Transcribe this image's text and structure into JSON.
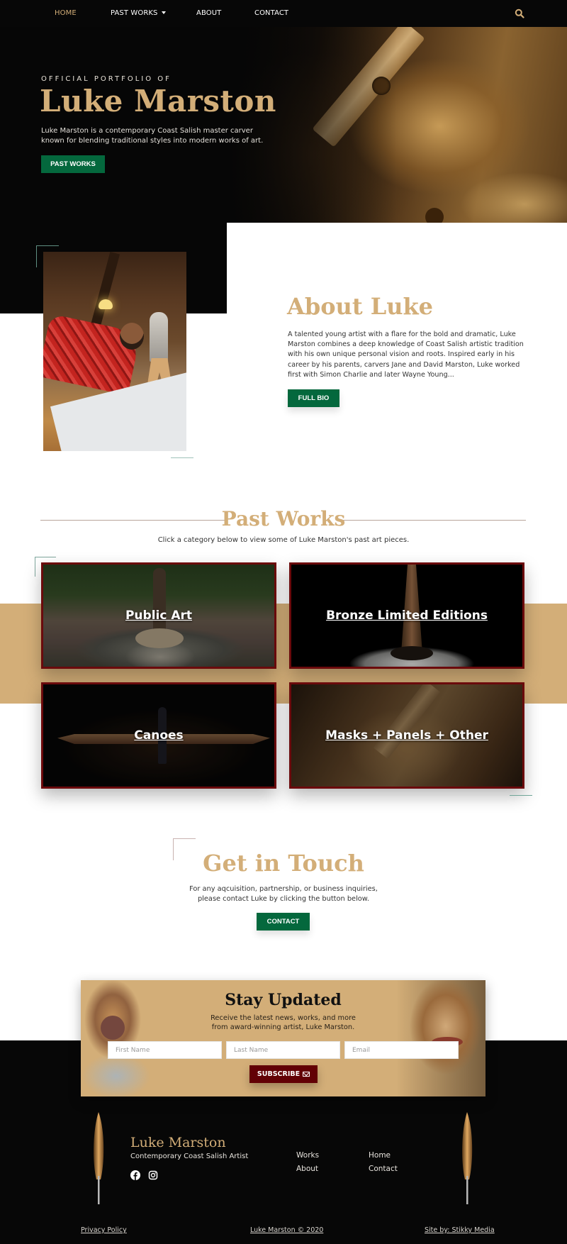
{
  "nav": {
    "items": [
      {
        "label": "HOME",
        "active": true
      },
      {
        "label": "PAST WORKS",
        "has_dropdown": true
      },
      {
        "label": "ABOUT"
      },
      {
        "label": "CONTACT"
      }
    ],
    "search_icon": "search-icon"
  },
  "hero": {
    "eyebrow": "OFFICIAL PORTFOLIO OF",
    "title": "Luke Marston",
    "description": "Luke Marston is a contemporary Coast Salish master carver known for blending traditional styles into modern works of art.",
    "button_label": "PAST WORKS"
  },
  "about": {
    "title": "About Luke",
    "text": "A talented young artist with a flare for the bold and dramatic, Luke Marston combines a deep knowledge of Coast Salish artistic tradition with his own unique personal vision and roots. Inspired early in his career by his parents, carvers Jane and David Marston, Luke worked first with Simon Charlie and later Wayne Young...",
    "button_label": "FULL BIO"
  },
  "past_works": {
    "title": "Past Works",
    "subtitle": "Click a category below to view some of Luke Marston's past art pieces.",
    "categories": [
      {
        "label": "Public Art"
      },
      {
        "label": "Bronze Limited Editions"
      },
      {
        "label": "Canoes"
      },
      {
        "label": "Masks + Panels + Other"
      }
    ]
  },
  "contact": {
    "title": "Get in Touch",
    "text_line1": "For any aqcuisition, partnership, or business inquiries,",
    "text_line2": "please contact Luke by clicking the button below.",
    "button_label": "CONTACT"
  },
  "newsletter": {
    "title": "Stay Updated",
    "text_line1": "Receive the latest news, works, and more",
    "text_line2": "from award-winning artist, Luke Marston.",
    "first_name_placeholder": "First Name",
    "last_name_placeholder": "Last Name",
    "email_placeholder": "Email",
    "button_label": "SUBSCRIBE"
  },
  "footer": {
    "name": "Luke Marston",
    "tagline": "Contemporary Coast Salish Artist",
    "social": [
      "facebook-icon",
      "instagram-icon"
    ],
    "links_col1": [
      "Works",
      "About"
    ],
    "links_col2": [
      "Home",
      "Contact"
    ],
    "privacy": "Privacy Policy",
    "copyright": "Luke Marston © 2020",
    "credit": "Site by: Stikky Media"
  },
  "colors": {
    "gold": "#d3ae78",
    "green": "#04683d",
    "maroon": "#620005",
    "dark": "#070707"
  }
}
